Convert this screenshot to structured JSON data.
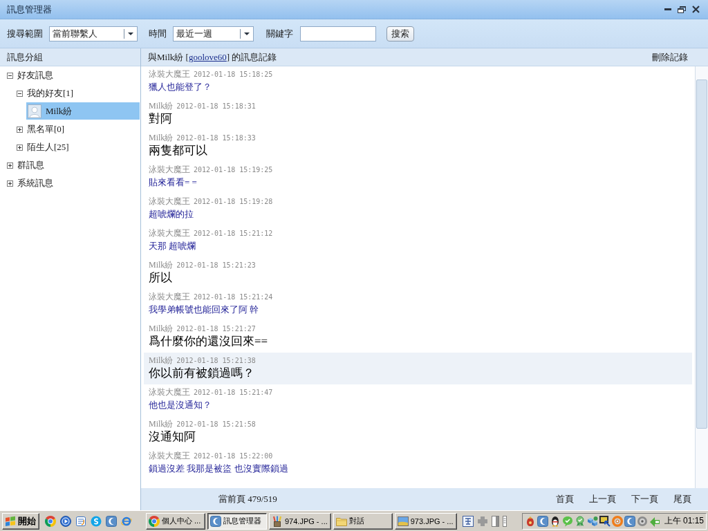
{
  "window": {
    "title": "訊息管理器"
  },
  "search": {
    "scope": {
      "label": "搜尋範圍",
      "value": "當前聯繫人"
    },
    "period": {
      "label": "時間",
      "value": "最近一週"
    },
    "keyword": {
      "label": "關鍵字"
    },
    "button": "搜索"
  },
  "sidebar": {
    "title": "訊息分組",
    "items": [
      {
        "label": "好友訊息",
        "kind": "group",
        "expanded": true,
        "selected": false,
        "children": [
          {
            "label": "我的好友[1]",
            "kind": "group",
            "expanded": true,
            "selected": false,
            "children": [
              {
                "label": "Milk紛",
                "kind": "contact",
                "selected": true
              }
            ]
          },
          {
            "label": "黑名單[0]",
            "kind": "group",
            "expanded": false,
            "selected": false
          },
          {
            "label": "陌生人[25]",
            "kind": "group",
            "expanded": false,
            "selected": false
          }
        ]
      },
      {
        "label": "群訊息",
        "kind": "group",
        "expanded": false,
        "selected": false
      },
      {
        "label": "系統訊息",
        "kind": "group",
        "expanded": false,
        "selected": false
      }
    ]
  },
  "conversation": {
    "title_before": "與Milk紛 [",
    "title_link": "goolove60",
    "title_after": "] 的訊息記錄",
    "delete_link": "刪除記錄",
    "messages": [
      {
        "sender": "泳裝大魔王",
        "time": "2012-01-18 15:18:25",
        "text": "獵人也能登了？",
        "kind": "own",
        "highlighted": false
      },
      {
        "sender": "Milk紛",
        "time": "2012-01-18 15:18:31",
        "text": "對阿",
        "kind": "contact",
        "highlighted": false
      },
      {
        "sender": "Milk紛",
        "time": "2012-01-18 15:18:33",
        "text": "兩隻都可以",
        "kind": "contact",
        "highlighted": false
      },
      {
        "sender": "泳裝大魔王",
        "time": "2012-01-18 15:19:25",
        "text": "貼來看看= =",
        "kind": "own",
        "highlighted": false
      },
      {
        "sender": "泳裝大魔王",
        "time": "2012-01-18 15:19:28",
        "text": "超唬爛的拉",
        "kind": "own",
        "highlighted": false
      },
      {
        "sender": "泳裝大魔王",
        "time": "2012-01-18 15:21:12",
        "text": "天那 超唬爛",
        "kind": "own",
        "highlighted": false
      },
      {
        "sender": "Milk紛",
        "time": "2012-01-18 15:21:23",
        "text": "所以",
        "kind": "contact",
        "highlighted": false
      },
      {
        "sender": "泳裝大魔王",
        "time": "2012-01-18 15:21:24",
        "text": "我學弟帳號也能回來了阿 幹",
        "kind": "own",
        "highlighted": false
      },
      {
        "sender": "Milk紛",
        "time": "2012-01-18 15:21:27",
        "text": "爲什麼你的還沒回來==",
        "kind": "contact",
        "highlighted": false
      },
      {
        "sender": "Milk紛",
        "time": "2012-01-18 15:21:38",
        "text": "你以前有被鎖過嗎？",
        "kind": "contact",
        "highlighted": true
      },
      {
        "sender": "泳裝大魔王",
        "time": "2012-01-18 15:21:47",
        "text": "他也是沒通知？",
        "kind": "own",
        "highlighted": false
      },
      {
        "sender": "Milk紛",
        "time": "2012-01-18 15:21:58",
        "text": "沒通知阿",
        "kind": "contact",
        "highlighted": false
      },
      {
        "sender": "泳裝大魔王",
        "time": "2012-01-18 15:22:00",
        "text": "鎖過沒差 我那是被盜 也沒實際鎖過",
        "kind": "own",
        "highlighted": false
      }
    ],
    "page_info": "當前頁 479/519",
    "pager": [
      "首頁",
      "上一頁",
      "下一頁",
      "尾頁"
    ]
  },
  "taskbar": {
    "start": "開始",
    "tasks": [
      {
        "label": "個人中心 ...",
        "selected": false
      },
      {
        "label": "訊息管理器",
        "selected": true
      },
      {
        "label": "974.JPG - ...",
        "selected": false
      },
      {
        "label": "對話",
        "selected": false
      },
      {
        "label": "973.JPG - ...",
        "selected": false
      }
    ],
    "clock": "上午 01:15"
  }
}
